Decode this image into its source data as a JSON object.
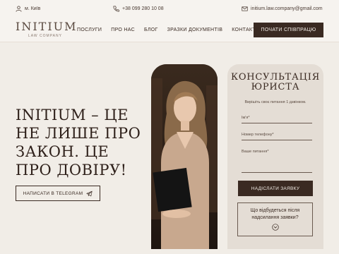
{
  "topbar": {
    "location": "м. Київ",
    "phone": "+38 099 280 10 08",
    "email": "initium.law.company@gmail.com"
  },
  "header": {
    "logo_name": "INITIUM",
    "logo_sub": "LAW COMPANY",
    "nav": [
      "ПОСЛУГИ",
      "ПРО НАС",
      "БЛОГ",
      "ЗРАЗКИ ДОКУМЕНТІВ",
      "КОНТАКТИ"
    ],
    "cta": "ПОЧАТИ СПІВПРАЦЮ"
  },
  "hero": {
    "title": "INITIUM – ЦЕ НЕ ЛИШЕ ПРО ЗАКОН. ЦЕ ПРО ДОВІРУ!",
    "telegram_button": "НАПИСАТИ В TELEGRAM"
  },
  "form": {
    "title_line1": "КОНСУЛЬТАЦІЯ",
    "title_line2": "ЮРИСТА",
    "description": "Вирішіть своє питання 1 дзвінком.",
    "name_placeholder": "Ім'я*",
    "phone_placeholder": "Номер телефону*",
    "question_placeholder": "Ваше питання*",
    "submit": "НАДІСЛАТИ ЗАЯВКУ",
    "faq_question": "Що відбудеться після надсилання заявки?"
  },
  "colors": {
    "background": "#f1ede7",
    "dark": "#3a2a22",
    "card": "#e4ddd5"
  }
}
